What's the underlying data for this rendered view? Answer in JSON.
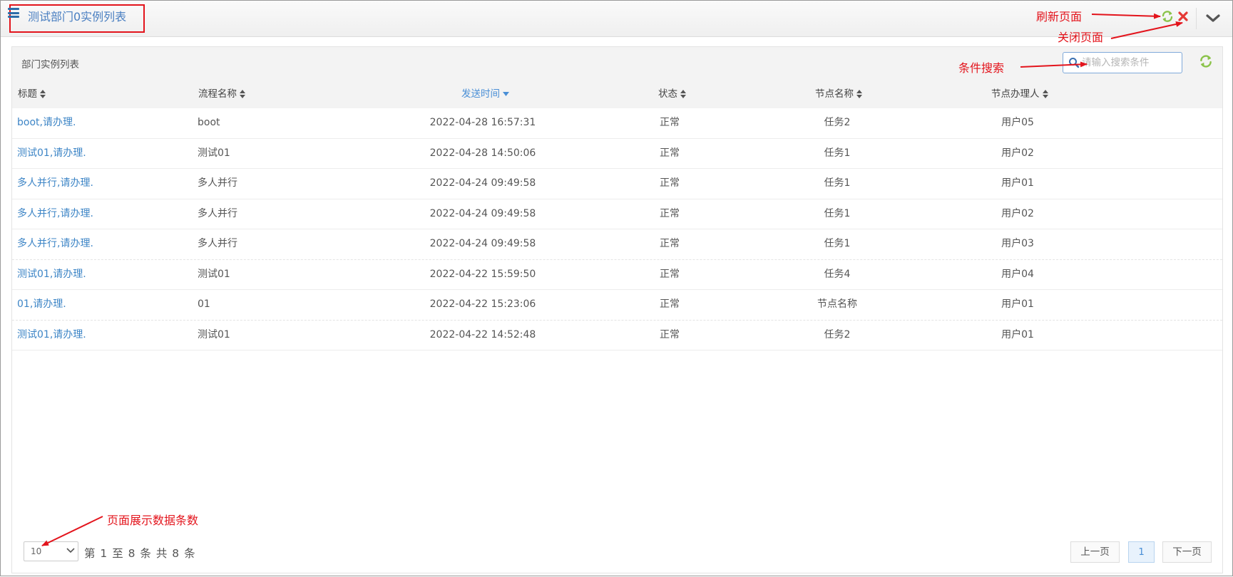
{
  "header": {
    "title": "测试部门0实例列表",
    "menu_icon": "menu-icon",
    "refresh_icon": "refresh-icon",
    "close_icon": "close-icon",
    "collapse_icon": "chevron-down-icon"
  },
  "panel": {
    "title": "部门实例列表",
    "search": {
      "placeholder": "请输入搜索条件",
      "value": ""
    }
  },
  "table": {
    "columns": [
      {
        "label": "标题",
        "sort": "none"
      },
      {
        "label": "流程名称",
        "sort": "none"
      },
      {
        "label": "发送时间",
        "sort": "desc"
      },
      {
        "label": "状态",
        "sort": "none"
      },
      {
        "label": "节点名称",
        "sort": "none"
      },
      {
        "label": "节点办理人",
        "sort": "none"
      }
    ],
    "rows": [
      {
        "title": "boot,请办理.",
        "process": "boot",
        "time": "2022-04-28 16:57:31",
        "status": "正常",
        "node": "任务2",
        "handler": "用户05"
      },
      {
        "title": "测试01,请办理.",
        "process": "测试01",
        "time": "2022-04-28 14:50:06",
        "status": "正常",
        "node": "任务1",
        "handler": "用户02"
      },
      {
        "title": "多人并行,请办理.",
        "process": "多人并行",
        "time": "2022-04-24 09:49:58",
        "status": "正常",
        "node": "任务1",
        "handler": "用户01"
      },
      {
        "title": "多人并行,请办理.",
        "process": "多人并行",
        "time": "2022-04-24 09:49:58",
        "status": "正常",
        "node": "任务1",
        "handler": "用户02"
      },
      {
        "title": "多人并行,请办理.",
        "process": "多人并行",
        "time": "2022-04-24 09:49:58",
        "status": "正常",
        "node": "任务1",
        "handler": "用户03"
      },
      {
        "title": "测试01,请办理.",
        "process": "测试01",
        "time": "2022-04-22 15:59:50",
        "status": "正常",
        "node": "任务4",
        "handler": "用户04"
      },
      {
        "title": "01,请办理.",
        "process": "01",
        "time": "2022-04-22 15:23:06",
        "status": "正常",
        "node": "节点名称",
        "handler": "用户01"
      },
      {
        "title": "测试01,请办理.",
        "process": "测试01",
        "time": "2022-04-22 14:52:48",
        "status": "正常",
        "node": "任务2",
        "handler": "用户01"
      }
    ]
  },
  "footer": {
    "page_size": "10",
    "page_info": "第 1 至 8 条 共 8 条",
    "prev": "上一页",
    "current_page": "1",
    "next": "下一页"
  },
  "annotations": {
    "refresh": "刷新页面",
    "close": "关闭页面",
    "search": "条件搜索",
    "page_size": "页面展示数据条数"
  },
  "colors": {
    "link": "#3d85c6",
    "title": "#4a7fc1",
    "annotation": "#e3141c",
    "refresh": "#8bc34a",
    "close": "#e53935"
  }
}
